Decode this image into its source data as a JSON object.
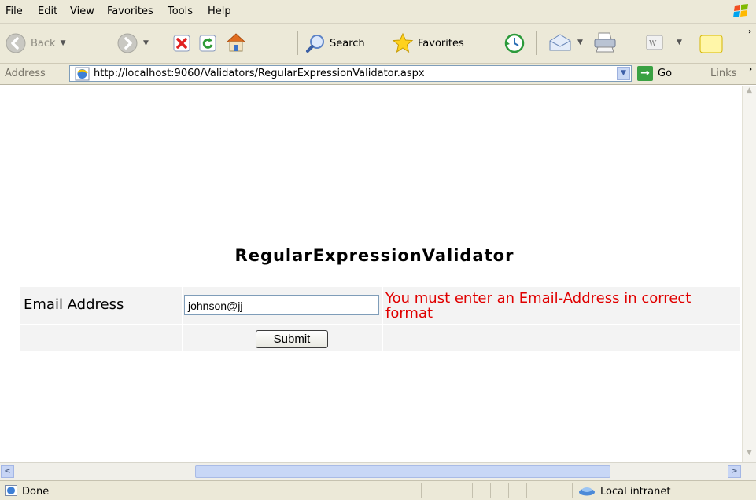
{
  "menu": [
    "File",
    "Edit",
    "View",
    "Favorites",
    "Tools",
    "Help"
  ],
  "toolbar": {
    "back_label": "Back",
    "search_label": "Search",
    "favorites_label": "Favorites"
  },
  "address": {
    "label": "Address",
    "url": "http://localhost:9060/Validators/RegularExpressionValidator.aspx",
    "go_label": "Go",
    "links_label": "Links"
  },
  "page": {
    "heading": "RegularExpressionValidator",
    "email_label": "Email Address",
    "email_value": "johnson@jj",
    "error_message": "You must enter an Email-Address in correct format",
    "submit_label": "Submit"
  },
  "status": {
    "text": "Done",
    "zone": "Local intranet"
  },
  "colors": {
    "error": "#e00000",
    "chrome": "#ece9d8"
  }
}
